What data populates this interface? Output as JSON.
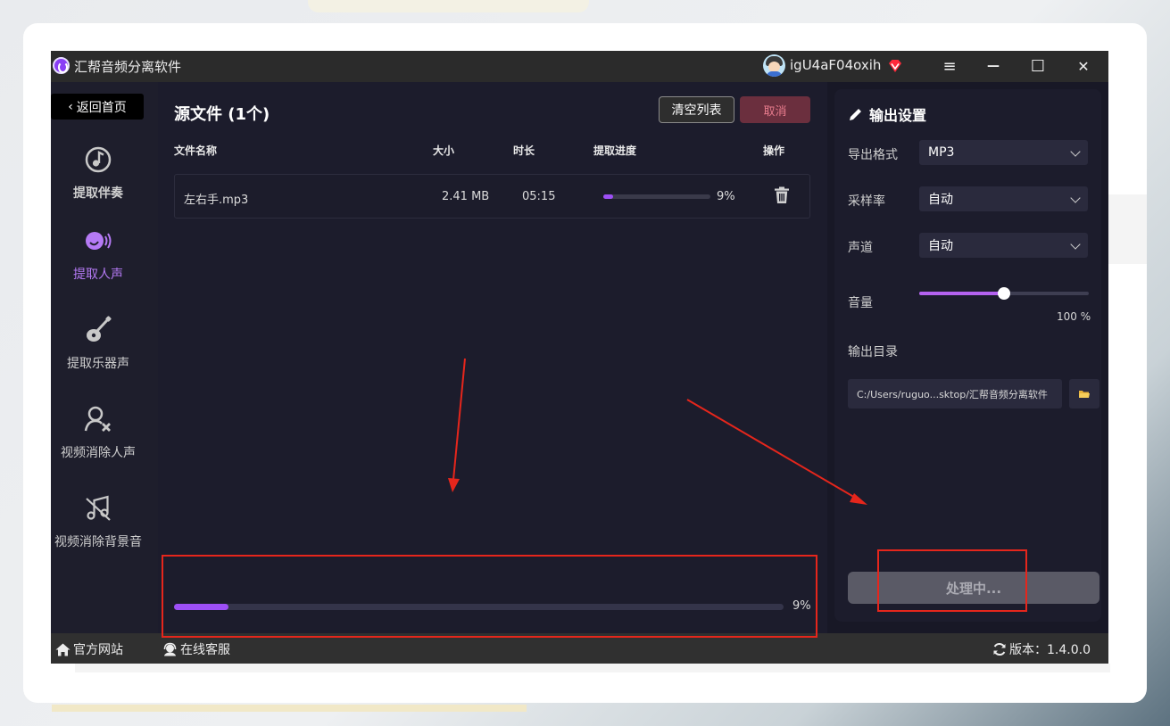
{
  "app": {
    "title": "汇帮音频分离软件",
    "username": "igU4aF04oxih"
  },
  "window_controls": {
    "menu_icon": "≡",
    "minimize_icon": "—",
    "maximize_icon": "☐",
    "close_icon": "✕"
  },
  "sidebar": {
    "home_label": "返回首页",
    "items": [
      {
        "label": "提取伴奏",
        "icon": "music-note-icon"
      },
      {
        "label": "提取人声",
        "icon": "voice-icon"
      },
      {
        "label": "提取乐器声",
        "icon": "guitar-icon"
      },
      {
        "label": "视频消除人声",
        "icon": "user-remove-icon"
      },
      {
        "label": "视频消除背景音",
        "icon": "music-mute-icon"
      }
    ]
  },
  "main": {
    "source_title": "源文件 (1个)",
    "clear_button": "清空列表",
    "cancel_button": "取消",
    "columns": [
      "文件名称",
      "大小",
      "时长",
      "提取进度",
      "操作"
    ],
    "files": [
      {
        "name": "左右手.mp3",
        "size": "2.41 MB",
        "duration": "05:15",
        "progress_text": "9%",
        "progress": 0.09
      }
    ],
    "overall_progress": {
      "text": "9%",
      "value": 0.09
    }
  },
  "output": {
    "title": "输出设置",
    "format_label": "导出格式",
    "format_value": "MP3",
    "sample_rate_label": "采样率",
    "sample_rate_value": "自动",
    "channel_label": "声道",
    "channel_value": "自动",
    "volume_label": "音量",
    "volume_text": "100 %",
    "volume_value": 0.5,
    "dir_label": "输出目录",
    "dir_value": "C:/Users/ruguo...sktop/汇帮音频分离软件",
    "process_button": "处理中..."
  },
  "footer": {
    "website": "官方网站",
    "support": "在线客服",
    "version": "版本：1.4.0.0"
  },
  "colors": {
    "accent": "#9d4ff6",
    "annotation": "#e5261c",
    "cancel_bg": "#6b2f3e",
    "window_bg": "#181826"
  }
}
